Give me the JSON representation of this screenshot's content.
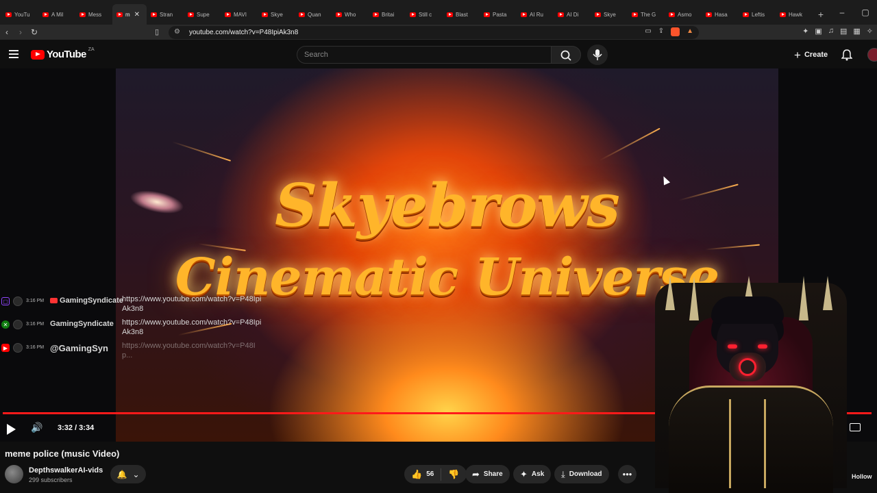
{
  "browser": {
    "tabs": [
      {
        "label": "YouTu",
        "active": false
      },
      {
        "label": "A Mil",
        "active": false
      },
      {
        "label": "Mess",
        "active": false
      },
      {
        "label": "m",
        "active": true
      },
      {
        "label": "Stran",
        "active": false
      },
      {
        "label": "Supe",
        "active": false
      },
      {
        "label": "MAVI",
        "active": false
      },
      {
        "label": "Skye",
        "active": false
      },
      {
        "label": "Quan",
        "active": false
      },
      {
        "label": "Who",
        "active": false
      },
      {
        "label": "Britai",
        "active": false
      },
      {
        "label": "Still c",
        "active": false
      },
      {
        "label": "Blast",
        "active": false
      },
      {
        "label": "Pasta",
        "active": false
      },
      {
        "label": "AI Ru",
        "active": false
      },
      {
        "label": "AI Di",
        "active": false
      },
      {
        "label": "Skye",
        "active": false
      },
      {
        "label": "The G",
        "active": false
      },
      {
        "label": "Asmo",
        "active": false
      },
      {
        "label": "Hasa",
        "active": false
      },
      {
        "label": "Leftis",
        "active": false
      },
      {
        "label": "Hawk",
        "active": false
      }
    ],
    "new_tab": "+",
    "url": "youtube.com/watch?v=P48IpiAk3n8"
  },
  "header": {
    "logo_text": "YouTube",
    "country_code": "ZA",
    "search_placeholder": "Search",
    "create_label": "Create",
    "create_plus": "+"
  },
  "video": {
    "art_line1": "Skyebrows",
    "art_line2": "Cinematic Universe",
    "time": "3:32 / 3:34",
    "progress_fraction": 0.994
  },
  "chat": [
    {
      "platform": "twitch",
      "time": "3:16 PM",
      "name": "GamingSyndicate",
      "message": "https://www.youtube.com/watch?v=P48IpiAk3n8",
      "faded": false
    },
    {
      "platform": "xbox",
      "time": "3:16 PM",
      "name": "GamingSyndicate",
      "message": "https://www.youtube.com/watch?v=P48IpiAk3n8",
      "faded": false
    },
    {
      "platform": "youtube",
      "time": "3:16 PM",
      "name": "@GamingSyn",
      "message": "https://www.youtube.com/watch?v=P48Ip...",
      "faded": true
    }
  ],
  "below": {
    "title": "meme police (music Video)",
    "channel": "DepthswalkerAI-vids",
    "subscribers": "299 subscribers",
    "likes": "56",
    "share": "Share",
    "ask": "Ask",
    "download": "Download",
    "hollow": "Hollow"
  }
}
